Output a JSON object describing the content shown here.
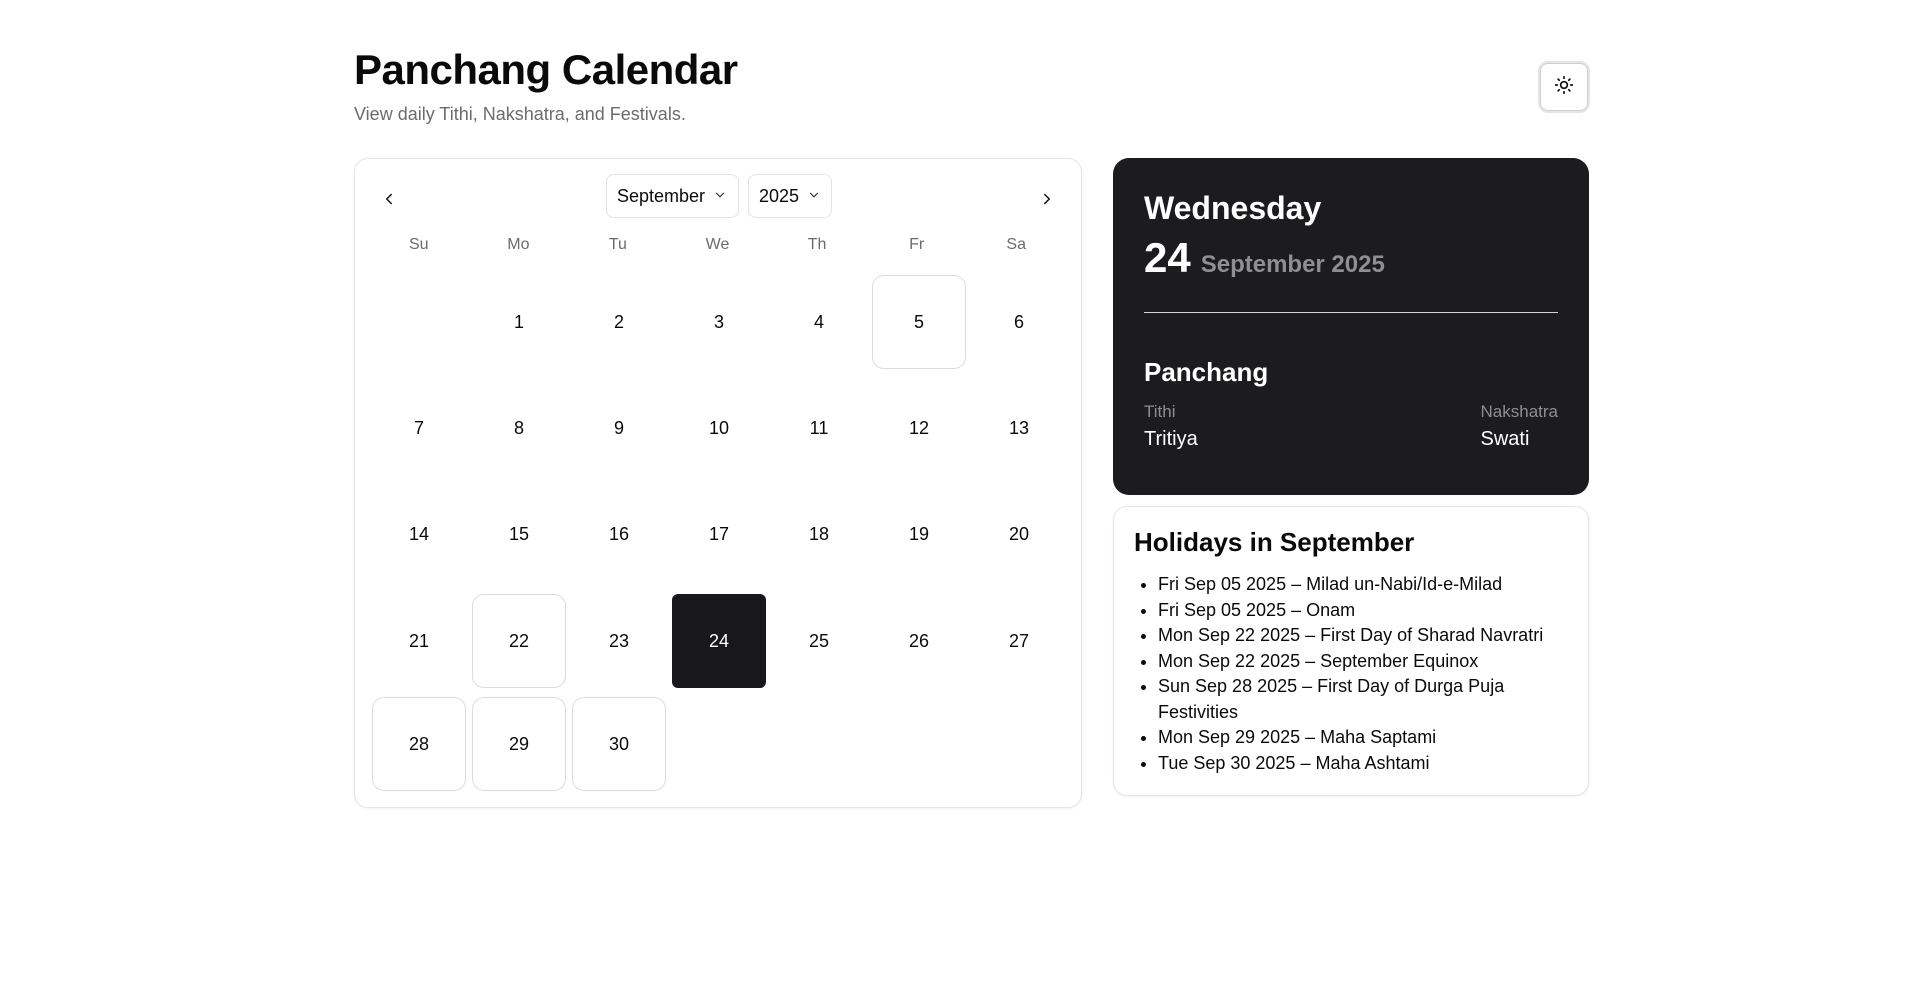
{
  "header": {
    "title": "Panchang Calendar",
    "subtitle": "View daily Tithi, Nakshatra, and Festivals."
  },
  "theme_toggle": {
    "icon": "sun-icon"
  },
  "calendar": {
    "month": "September",
    "year": "2025",
    "weekdays": [
      "Su",
      "Mo",
      "Tu",
      "We",
      "Th",
      "Fr",
      "Sa"
    ],
    "days": [
      {
        "label": ""
      },
      {
        "label": "1"
      },
      {
        "label": "2"
      },
      {
        "label": "3"
      },
      {
        "label": "4"
      },
      {
        "label": "5",
        "holiday": true
      },
      {
        "label": "6"
      },
      {
        "label": "7"
      },
      {
        "label": "8"
      },
      {
        "label": "9"
      },
      {
        "label": "10"
      },
      {
        "label": "11"
      },
      {
        "label": "12"
      },
      {
        "label": "13"
      },
      {
        "label": "14"
      },
      {
        "label": "15"
      },
      {
        "label": "16"
      },
      {
        "label": "17"
      },
      {
        "label": "18"
      },
      {
        "label": "19"
      },
      {
        "label": "20"
      },
      {
        "label": "21"
      },
      {
        "label": "22",
        "holiday": true
      },
      {
        "label": "23"
      },
      {
        "label": "24",
        "selected": true
      },
      {
        "label": "25"
      },
      {
        "label": "26"
      },
      {
        "label": "27"
      },
      {
        "label": "28",
        "holiday": true
      },
      {
        "label": "29",
        "holiday": true
      },
      {
        "label": "30",
        "holiday": true
      },
      {
        "label": ""
      },
      {
        "label": ""
      },
      {
        "label": ""
      },
      {
        "label": ""
      }
    ]
  },
  "selected_date": {
    "weekday": "Wednesday",
    "day": "24",
    "month_year": "September 2025",
    "section_title": "Panchang",
    "tithi_label": "Tithi",
    "tithi_value": "Tritiya",
    "nakshatra_label": "Nakshatra",
    "nakshatra_value": "Swati"
  },
  "holidays": {
    "title": "Holidays in September",
    "items": [
      "Fri Sep 05 2025 – Milad un-Nabi/Id-e-Milad",
      "Fri Sep 05 2025 – Onam",
      "Mon Sep 22 2025 – First Day of Sharad Navratri",
      "Mon Sep 22 2025 – September Equinox",
      "Sun Sep 28 2025 – First Day of Durga Puja Festivities",
      "Mon Sep 29 2025 – Maha Saptami",
      "Tue Sep 30 2025 – Maha Ashtami"
    ]
  },
  "colors": {
    "selected_bg": "#18181b",
    "card_dark": "#1c1c1e",
    "muted_text": "#6b6b70",
    "border": "#e4e4e7"
  }
}
